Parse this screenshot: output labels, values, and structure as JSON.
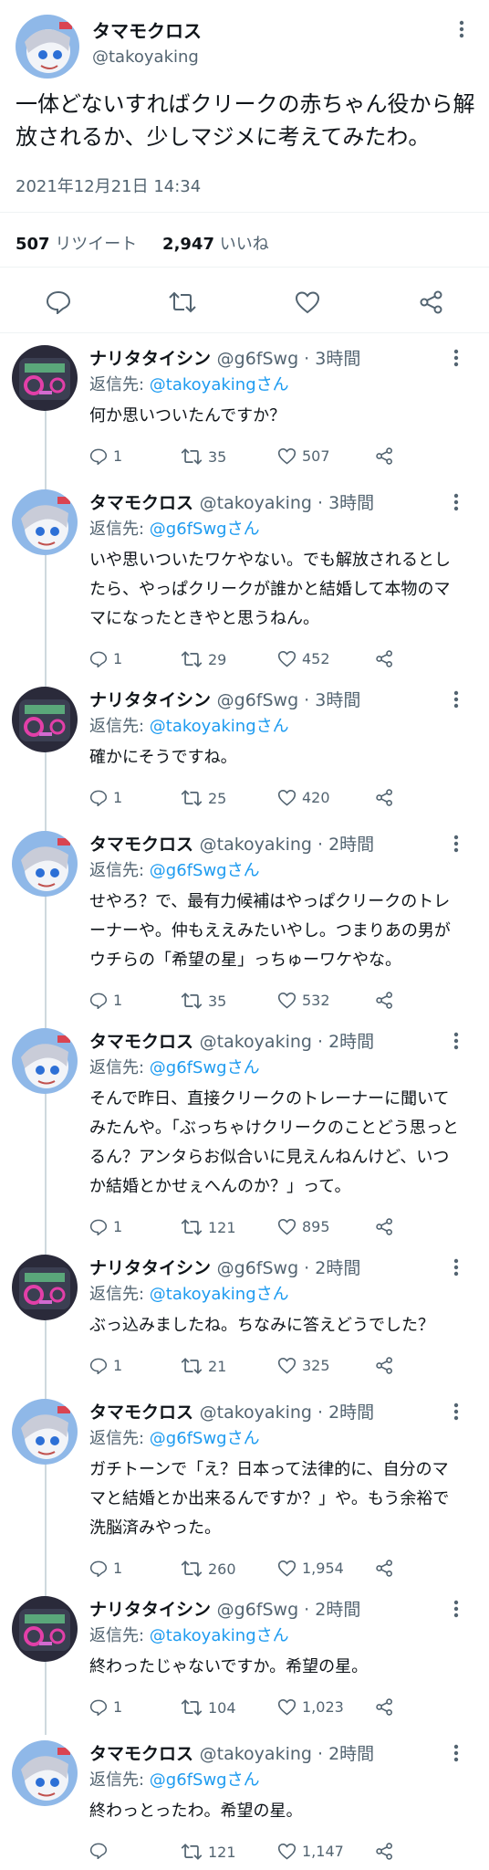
{
  "main_tweet": {
    "name": "タマモクロス",
    "handle": "@takoyaking",
    "more_icon": "more-icon",
    "text": "一体どないすればクリークの赤ちゃん役から解放されるか、少しマジメに考えてみたわ。",
    "datetime": "2021年12月21日 14:34",
    "retweets_count": "507",
    "retweets_label": "リツイート",
    "likes_count": "2,947",
    "likes_label": "いいね"
  },
  "colors": {
    "mention": "#1d9bf0",
    "secondary": "#536471",
    "divider": "#eff3f4",
    "thread_line": "#cfd9de"
  },
  "replies": [
    {
      "name": "ナリタタイシン",
      "meta": "@g6fSwg · 3時間",
      "reply_prefix": "返信先: ",
      "reply_to": "@takoyakingさん",
      "text": "何か思いついたんですか？",
      "replies": "1",
      "retweets": "35",
      "likes": "507",
      "avatar": "tishin"
    },
    {
      "name": "タマモクロス",
      "meta": "@takoyaking · 3時間",
      "reply_prefix": "返信先: ",
      "reply_to": "@g6fSwgさん",
      "text": "いや思いついたワケやない。でも解放されるとしたら、やっぱクリークが誰かと結婚して本物のママになったときやと思うねん。",
      "replies": "1",
      "retweets": "29",
      "likes": "452",
      "avatar": "tamamo"
    },
    {
      "name": "ナリタタイシン",
      "meta": "@g6fSwg · 3時間",
      "reply_prefix": "返信先: ",
      "reply_to": "@takoyakingさん",
      "text": "確かにそうですね。",
      "replies": "1",
      "retweets": "25",
      "likes": "420",
      "avatar": "tishin"
    },
    {
      "name": "タマモクロス",
      "meta": "@takoyaking · 2時間",
      "reply_prefix": "返信先: ",
      "reply_to": "@g6fSwgさん",
      "text": "せやろ？で、最有力候補はやっぱクリークのトレーナーや。仲もええみたいやし。つまりあの男がウチらの「希望の星」っちゅーワケやな。",
      "replies": "1",
      "retweets": "35",
      "likes": "532",
      "avatar": "tamamo"
    },
    {
      "name": "タマモクロス",
      "meta": "@takoyaking · 2時間",
      "reply_prefix": "返信先: ",
      "reply_to": "@g6fSwgさん",
      "text": "そんで昨日、直接クリークのトレーナーに聞いてみたんや。「ぶっちゃけクリークのことどう思っとるん？アンタらお似合いに見えんねんけど、いつか結婚とかせぇへんのか？」って。",
      "replies": "1",
      "retweets": "121",
      "likes": "895",
      "avatar": "tamamo"
    },
    {
      "name": "ナリタタイシン",
      "meta": "@g6fSwg · 2時間",
      "reply_prefix": "返信先: ",
      "reply_to": "@takoyakingさん",
      "text": "ぶっ込みましたね。ちなみに答えどうでした？",
      "replies": "1",
      "retweets": "21",
      "likes": "325",
      "avatar": "tishin"
    },
    {
      "name": "タマモクロス",
      "meta": "@takoyaking · 2時間",
      "reply_prefix": "返信先: ",
      "reply_to": "@g6fSwgさん",
      "text": "ガチトーンで「え？日本って法律的に、自分のママと結婚とか出来るんですか？」や。もう余裕で洗脳済みやった。",
      "replies": "1",
      "retweets": "260",
      "likes": "1,954",
      "avatar": "tamamo"
    },
    {
      "name": "ナリタタイシン",
      "meta": "@g6fSwg · 2時間",
      "reply_prefix": "返信先: ",
      "reply_to": "@takoyakingさん",
      "text": "終わったじゃないですか。希望の星。",
      "replies": "1",
      "retweets": "104",
      "likes": "1,023",
      "avatar": "tishin"
    },
    {
      "name": "タマモクロス",
      "meta": "@takoyaking · 2時間",
      "reply_prefix": "返信先: ",
      "reply_to": "@g6fSwgさん",
      "text": "終わっとったわ。希望の星。",
      "replies": "",
      "retweets": "121",
      "likes": "1,147",
      "avatar": "tamamo"
    }
  ]
}
